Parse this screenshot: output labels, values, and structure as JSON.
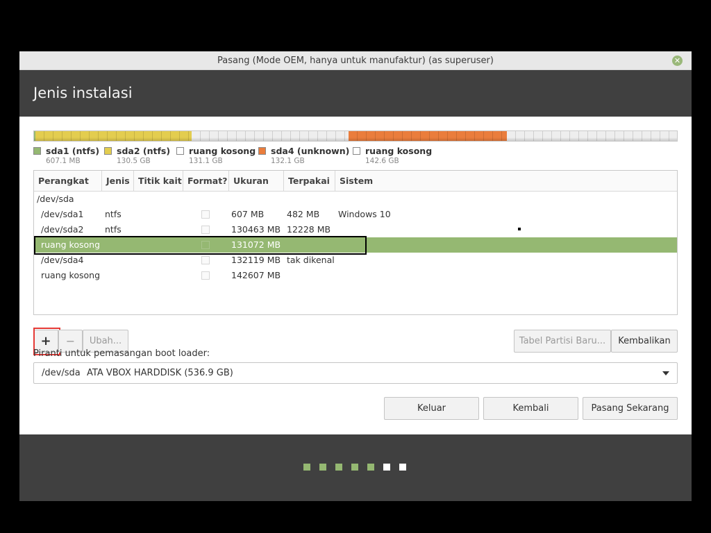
{
  "window": {
    "title": "Pasang (Mode OEM, hanya untuk manufaktur) (as superuser)",
    "close_glyph": "✕"
  },
  "header": {
    "title": "Jenis instalasi"
  },
  "usage_bar": {
    "segments": [
      {
        "partition": "sda1",
        "color": "#95b872",
        "pattern": "striped"
      },
      {
        "partition": "sda2",
        "color": "#e3cd4f",
        "pattern": "striped"
      },
      {
        "partition": "ruang kosong",
        "color": "#eeeeee",
        "pattern": "striped"
      },
      {
        "partition": "sda4",
        "color": "#ea7d3c",
        "pattern": "striped"
      },
      {
        "partition": "ruang kosong",
        "color": "#eeeeee",
        "pattern": "striped"
      }
    ]
  },
  "legend": [
    {
      "name": "sda1 (ntfs)",
      "size": "607.1 MB",
      "color": "#95b872"
    },
    {
      "name": "sda2 (ntfs)",
      "size": "130.5 GB",
      "color": "#e3cd4f"
    },
    {
      "name": "ruang kosong",
      "size": "131.1 GB",
      "color": "#ffffff"
    },
    {
      "name": "sda4 (unknown)",
      "size": "132.1 GB",
      "color": "#ea7d3c"
    },
    {
      "name": "ruang kosong",
      "size": "142.6 GB",
      "color": "#ffffff"
    }
  ],
  "table": {
    "columns": [
      "Perangkat",
      "Jenis",
      "Titik kait",
      "Format?",
      "Ukuran",
      "Terpakai",
      "Sistem"
    ],
    "rows": [
      {
        "device": "/dev/sda",
        "type": "",
        "mount": "",
        "format": null,
        "size": "",
        "used": "",
        "system": ""
      },
      {
        "device": "/dev/sda1",
        "type": "ntfs",
        "mount": "",
        "format": false,
        "size": "607 MB",
        "used": "482 MB",
        "system": "Windows 10"
      },
      {
        "device": "/dev/sda2",
        "type": "ntfs",
        "mount": "",
        "format": false,
        "size": "130463 MB",
        "used": "12228 MB",
        "system": ""
      },
      {
        "device": "ruang kosong",
        "type": "",
        "mount": "",
        "format": false,
        "size": "131072 MB",
        "used": "",
        "system": "",
        "selected": true
      },
      {
        "device": "/dev/sda4",
        "type": "",
        "mount": "",
        "format": false,
        "size": "132119 MB",
        "used": "tak dikenal",
        "system": ""
      },
      {
        "device": "ruang kosong",
        "type": "",
        "mount": "",
        "format": false,
        "size": "142607 MB",
        "used": "",
        "system": ""
      }
    ]
  },
  "partition_buttons": {
    "add": "+",
    "remove": "−",
    "change": "Ubah...",
    "new_table": "Tabel Partisi Baru...",
    "revert": "Kembalikan"
  },
  "bootloader": {
    "label": "Piranti untuk pemasangan boot loader:",
    "device": "/dev/sda",
    "description": "ATA VBOX HARDDISK (536.9 GB)"
  },
  "nav_buttons": {
    "quit": "Keluar",
    "back": "Kembali",
    "install": "Pasang Sekarang"
  },
  "progress": {
    "steps_total": 7,
    "steps_done": 5,
    "done_color": "#95b872",
    "pending_color": "#ffffff"
  }
}
